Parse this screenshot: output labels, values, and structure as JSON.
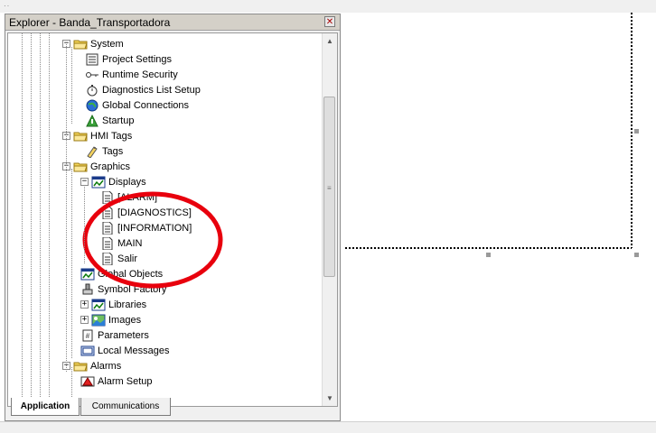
{
  "explorer": {
    "title": "Explorer - Banda_Transportadora",
    "close_icon": "close-icon"
  },
  "tree": [
    {
      "key": "system",
      "label": "System",
      "icon": "folder-open-icon",
      "expander": "minus"
    },
    {
      "key": "project-settings",
      "label": "Project Settings",
      "icon": "project-settings-icon"
    },
    {
      "key": "runtime-security",
      "label": "Runtime Security",
      "icon": "key-icon"
    },
    {
      "key": "diagnostics-list-setup",
      "label": "Diagnostics List Setup",
      "icon": "stopwatch-icon"
    },
    {
      "key": "global-connections",
      "label": "Global Connections",
      "icon": "globe-icon"
    },
    {
      "key": "startup",
      "label": "Startup",
      "icon": "startup-icon"
    },
    {
      "key": "hmi-tags",
      "label": "HMI Tags",
      "icon": "folder-open-icon",
      "expander": "minus"
    },
    {
      "key": "tags",
      "label": "Tags",
      "icon": "tags-icon"
    },
    {
      "key": "graphics",
      "label": "Graphics",
      "icon": "folder-open-icon",
      "expander": "minus"
    },
    {
      "key": "displays",
      "label": "Displays",
      "icon": "displays-icon",
      "expander": "minus"
    },
    {
      "key": "alarm-display",
      "label": "[ALARM]",
      "icon": "document-icon"
    },
    {
      "key": "diagnostics-display",
      "label": "[DIAGNOSTICS]",
      "icon": "document-icon"
    },
    {
      "key": "information-display",
      "label": "[INFORMATION]",
      "icon": "document-icon"
    },
    {
      "key": "main-display",
      "label": "MAIN",
      "icon": "document-icon"
    },
    {
      "key": "salir-display",
      "label": "Salir",
      "icon": "document-icon"
    },
    {
      "key": "global-objects",
      "label": "Global Objects",
      "icon": "displays-icon"
    },
    {
      "key": "symbol-factory",
      "label": "Symbol Factory",
      "icon": "symbol-factory-icon"
    },
    {
      "key": "libraries",
      "label": "Libraries",
      "icon": "displays-icon",
      "expander": "plus"
    },
    {
      "key": "images",
      "label": "Images",
      "icon": "images-icon",
      "expander": "plus"
    },
    {
      "key": "parameters",
      "label": "Parameters",
      "icon": "parameters-icon"
    },
    {
      "key": "local-messages",
      "label": "Local Messages",
      "icon": "local-messages-icon"
    },
    {
      "key": "alarms",
      "label": "Alarms",
      "icon": "folder-open-icon",
      "expander": "minus"
    },
    {
      "key": "alarm-setup",
      "label": "Alarm Setup",
      "icon": "alarm-setup-icon"
    }
  ],
  "annotation": {
    "color": "#e8000d",
    "shape": "ellipse"
  },
  "tabs": [
    {
      "label": "Application",
      "active": true
    },
    {
      "label": "Communications",
      "active": false
    }
  ],
  "colors": {
    "folder": "#f5d65c",
    "selection_dotted_border": "#000000",
    "handle": "#9a9a9a"
  }
}
